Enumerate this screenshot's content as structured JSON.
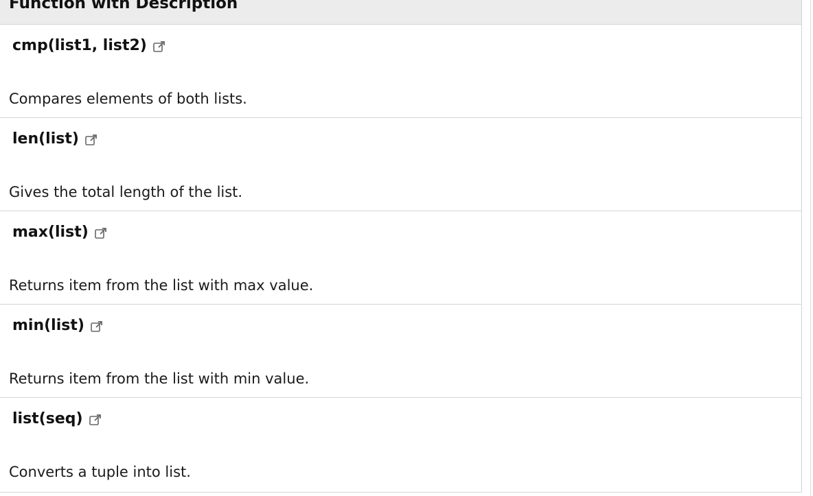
{
  "table": {
    "header": "Function with Description",
    "rows": [
      {
        "function": "cmp(list1, list2)",
        "description": "Compares elements of both lists.",
        "icon": "external-link-icon"
      },
      {
        "function": "len(list)",
        "description": "Gives the total length of the list.",
        "icon": "external-link-icon"
      },
      {
        "function": "max(list)",
        "description": "Returns item from the list with max value.",
        "icon": "external-link-icon"
      },
      {
        "function": "min(list)",
        "description": "Returns item from the list with min value.",
        "icon": "external-link-icon"
      },
      {
        "function": "list(seq)",
        "description": "Converts a tuple into list.",
        "icon": "external-link-icon"
      }
    ]
  },
  "colors": {
    "header_bg": "#ececec",
    "border": "#d6d6d6",
    "text": "#111111"
  }
}
